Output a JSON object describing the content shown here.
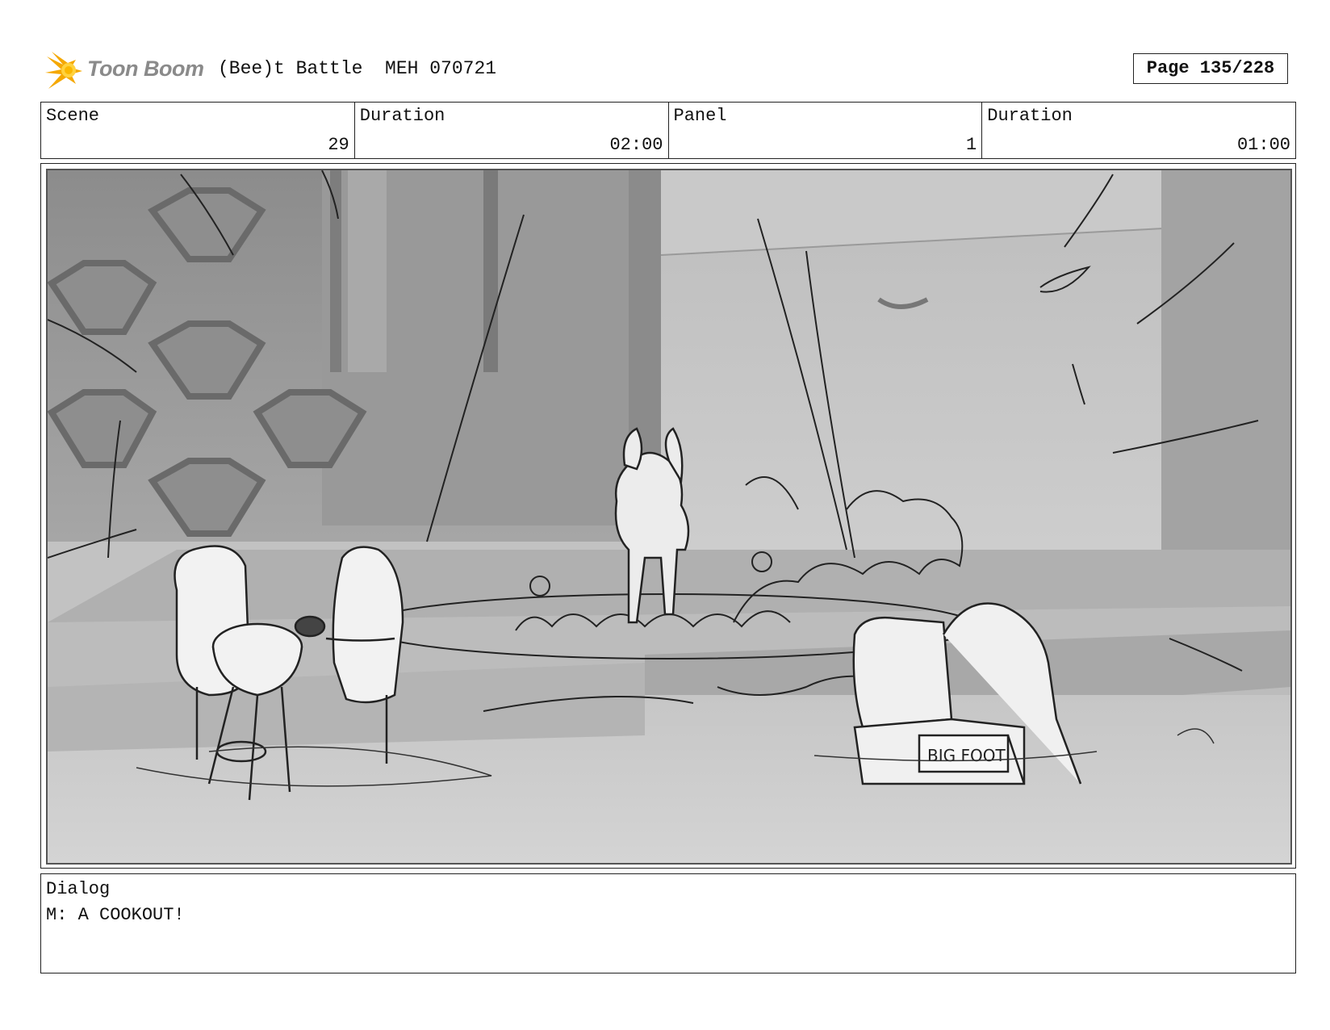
{
  "header": {
    "logo_text": "Toon Boom",
    "project_title": "(Bee)t Battle  MEH 070721",
    "page_label": "Page 135/228"
  },
  "info": {
    "scene_label": "Scene",
    "scene_value": "29",
    "scene_duration_label": "Duration",
    "scene_duration_value": "02:00",
    "panel_label": "Panel",
    "panel_value": "1",
    "panel_duration_label": "Duration",
    "panel_duration_value": "01:00"
  },
  "panel": {
    "sign_text": "BIG FOOT",
    "icon": "storyboard-sketch-image"
  },
  "dialog": {
    "label": "Dialog",
    "text": "M: A COOKOUT!"
  },
  "colors": {
    "logo_orange": "#f5a800",
    "logo_yellow": "#ffd23f",
    "logo_text": "#8a8a8a"
  }
}
